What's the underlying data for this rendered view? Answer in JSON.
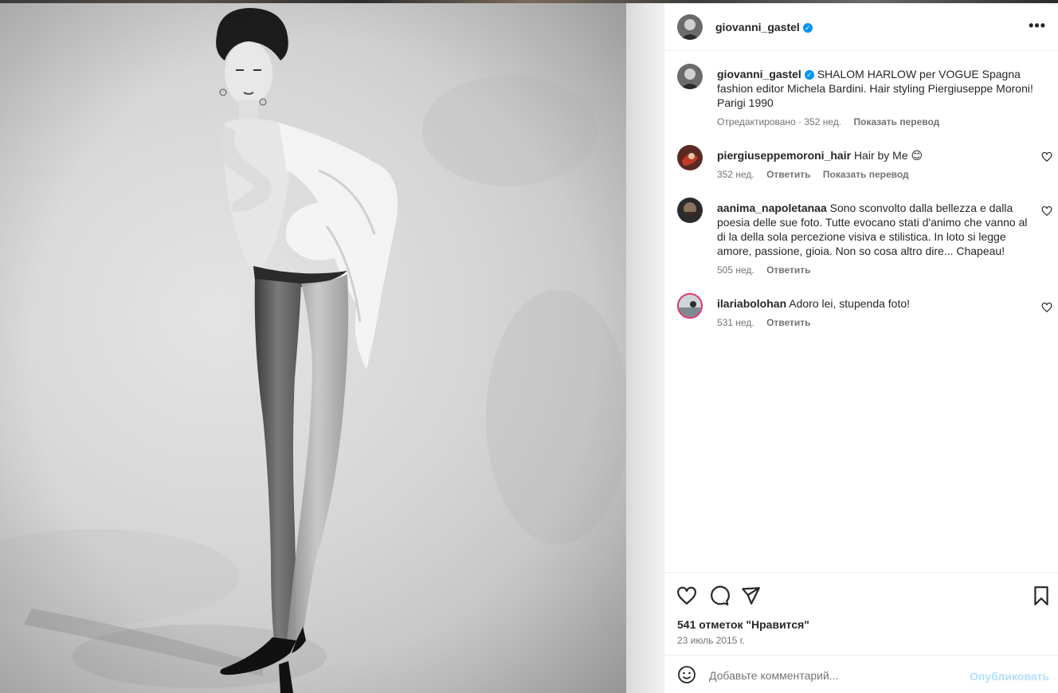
{
  "post": {
    "author": "giovanni_gastel",
    "more_label": "•••",
    "caption": {
      "username": "giovanni_gastel",
      "text": "SHALOM HARLOW per VOGUE Spagna fashion editor Michela Bardini. Hair styling Piergiuseppe Moroni! Parigi 1990",
      "edited": "Отредактировано · 352 нед.",
      "translate": "Показать перевод"
    },
    "comments": [
      {
        "username": "piergiuseppemoroni_hair",
        "text": "Hair by Me 😊",
        "age": "352 нед.",
        "reply": "Ответить",
        "translate": "Показать перевод"
      },
      {
        "username": "aanima_napoletanaa",
        "text": "Sono sconvolto dalla bellezza e dalla poesia delle sue foto. Tutte evocano stati d'animo che vanno al di la della sola percezione visiva e stilistica. In loto si legge amore, passione, gioia. Non so cosa altro dire... Chapeau!",
        "age": "505 нед.",
        "reply": "Ответить"
      },
      {
        "username": "ilariabolohan",
        "text": "Adoro lei, stupenda foto!",
        "age": "531 нед.",
        "reply": "Ответить"
      }
    ],
    "likes": "541 отметок \"Нравится\"",
    "date": "23 июль 2015 г.",
    "add_comment_placeholder": "Добавьте комментарий...",
    "publish_label": "Опубликовать"
  },
  "icons": {
    "like": "heart-icon",
    "comment": "comment-icon",
    "share": "share-icon",
    "save": "bookmark-icon",
    "emoji": "emoji-icon",
    "verified": "verified-badge-icon"
  },
  "colors": {
    "accent": "#0095f6",
    "publish_disabled": "#b2dffc",
    "secondary_text": "#737373"
  }
}
